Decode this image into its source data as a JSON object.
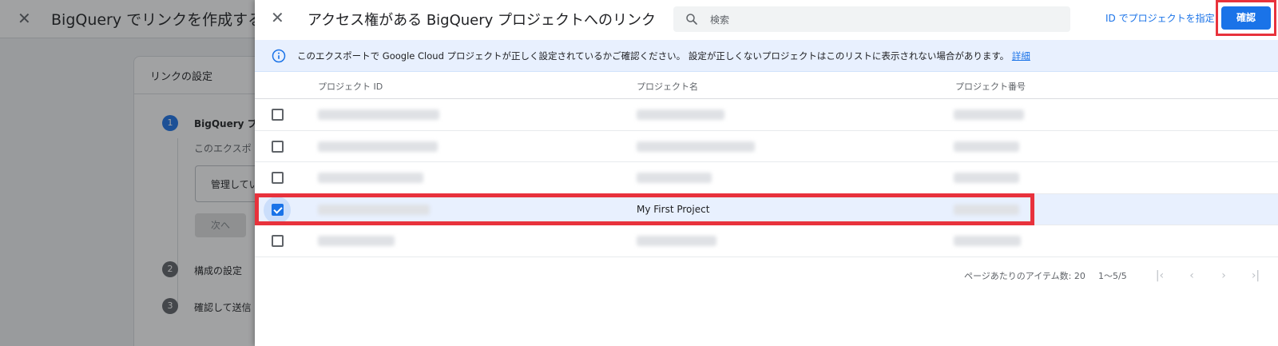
{
  "background": {
    "title": "BigQuery でリンクを作成する",
    "card_title": "リンクの設定",
    "steps": [
      {
        "number": "1",
        "label": "BigQuery プ"
      },
      {
        "number": "2",
        "label": "構成の設定"
      },
      {
        "number": "3",
        "label": "確認して送信"
      }
    ],
    "description": "このエクスポ",
    "input_value": "管理してい",
    "next_label": "次へ"
  },
  "panel": {
    "title": "アクセス権がある BigQuery プロジェクトへのリンク",
    "search_placeholder": "検索",
    "specify_by_id": "ID でプロジェクトを指定",
    "confirm": "確認"
  },
  "info": {
    "text": "このエクスポートで Google Cloud プロジェクトが正しく設定されているかご確認ください。 設定が正しくないプロジェクトはこのリストに表示されない場合があります。",
    "link": "詳細"
  },
  "table": {
    "columns": [
      "プロジェクト ID",
      "プロジェクト名",
      "プロジェクト番号"
    ],
    "rows": [
      {
        "checked": false,
        "name": ""
      },
      {
        "checked": false,
        "name": ""
      },
      {
        "checked": false,
        "name": ""
      },
      {
        "checked": true,
        "name": "My First Project"
      },
      {
        "checked": false,
        "name": ""
      }
    ]
  },
  "pager": {
    "items_per_page_label": "ページあたりのアイテム数: 20",
    "range": "1〜5/5"
  },
  "colors": {
    "accent": "#1a73e8",
    "highlight": "#e8323c"
  }
}
